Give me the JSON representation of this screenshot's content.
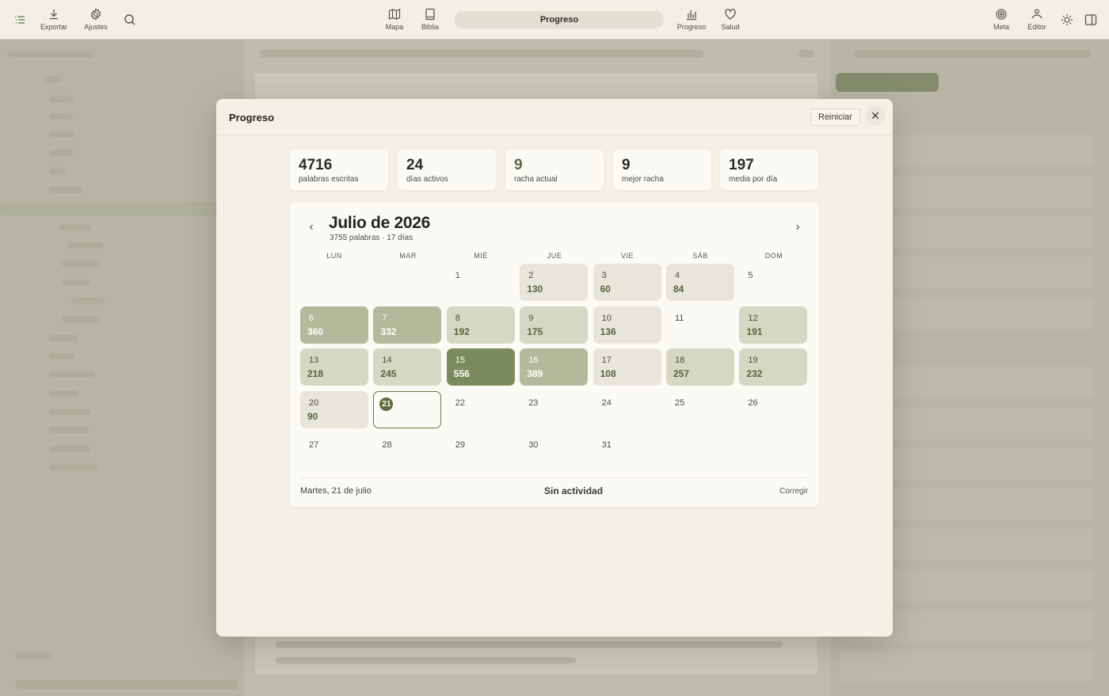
{
  "toolbar": {
    "export_label": "Exportar",
    "settings_label": "Ajustes",
    "map_label": "Mapa",
    "bible_label": "Biblia",
    "title": "Progreso",
    "progress_label": "Progreso",
    "health_label": "Salud",
    "goal_label": "Meta",
    "editor_label": "Editor"
  },
  "modal": {
    "title": "Progreso",
    "reset_label": "Reiniciar",
    "close_glyph": "✕",
    "stats": [
      {
        "value": "4716",
        "caption": "palabras escritas"
      },
      {
        "value": "24",
        "caption": "días activos"
      },
      {
        "value": "9",
        "caption": "racha actual"
      },
      {
        "value": "9",
        "caption": "mejor racha"
      },
      {
        "value": "197",
        "caption": "media por día"
      }
    ],
    "calendar": {
      "prev_glyph": "‹",
      "next_glyph": "›",
      "month_title": "Julio de 2026",
      "summary": "3755 palabras · 17 días",
      "weekdays": [
        "LUN",
        "MAR",
        "MIÉ",
        "JUE",
        "VIE",
        "SÁB",
        "DOM"
      ],
      "days": [
        {
          "d": "1",
          "w": "",
          "lvl": 0
        },
        {
          "d": "2",
          "w": "130",
          "lvl": 1
        },
        {
          "d": "3",
          "w": "60",
          "lvl": 1
        },
        {
          "d": "4",
          "w": "84",
          "lvl": 1
        },
        {
          "d": "5",
          "w": "",
          "lvl": 0
        },
        {
          "d": "6",
          "w": "360",
          "lvl": 3
        },
        {
          "d": "7",
          "w": "332",
          "lvl": 3
        },
        {
          "d": "8",
          "w": "192",
          "lvl": 2
        },
        {
          "d": "9",
          "w": "175",
          "lvl": 2
        },
        {
          "d": "10",
          "w": "136",
          "lvl": 1
        },
        {
          "d": "11",
          "w": "",
          "lvl": 0
        },
        {
          "d": "12",
          "w": "191",
          "lvl": 2
        },
        {
          "d": "13",
          "w": "218",
          "lvl": 2
        },
        {
          "d": "14",
          "w": "245",
          "lvl": 2
        },
        {
          "d": "15",
          "w": "556",
          "lvl": 4
        },
        {
          "d": "16",
          "w": "389",
          "lvl": 3
        },
        {
          "d": "17",
          "w": "108",
          "lvl": 1
        },
        {
          "d": "18",
          "w": "257",
          "lvl": 2
        },
        {
          "d": "19",
          "w": "232",
          "lvl": 2
        },
        {
          "d": "20",
          "w": "90",
          "lvl": 1
        },
        {
          "d": "21",
          "w": "",
          "lvl": 0,
          "today": true
        },
        {
          "d": "22",
          "w": "",
          "lvl": 0
        },
        {
          "d": "23",
          "w": "",
          "lvl": 0
        },
        {
          "d": "24",
          "w": "",
          "lvl": 0
        },
        {
          "d": "25",
          "w": "",
          "lvl": 0
        },
        {
          "d": "26",
          "w": "",
          "lvl": 0
        },
        {
          "d": "27",
          "w": "",
          "lvl": 0
        },
        {
          "d": "28",
          "w": "",
          "lvl": 0
        },
        {
          "d": "29",
          "w": "",
          "lvl": 0
        },
        {
          "d": "30",
          "w": "",
          "lvl": 0
        },
        {
          "d": "31",
          "w": "",
          "lvl": 0
        }
      ],
      "selected_date": "Martes, 21 de julio",
      "selected_status": "Sin actividad",
      "fix_label": "Corregir"
    }
  }
}
